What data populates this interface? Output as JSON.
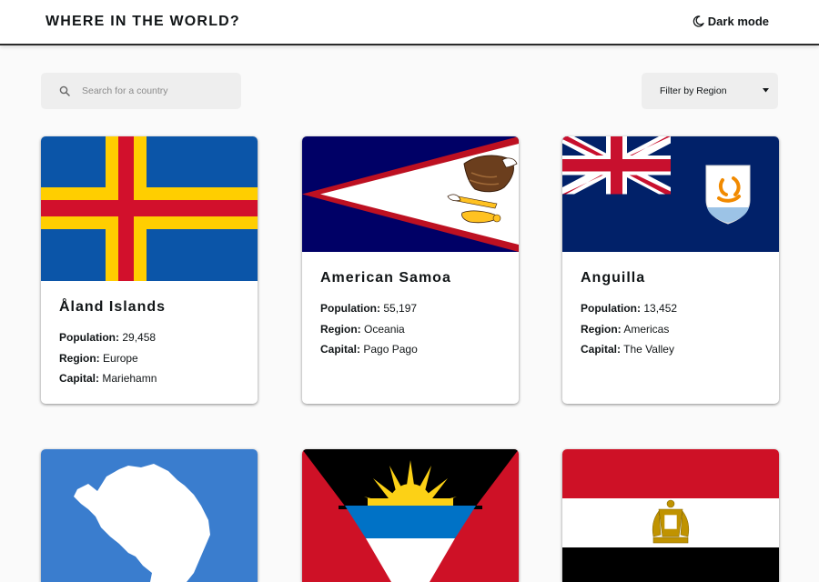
{
  "header": {
    "title": "WHERE IN THE WORLD?",
    "theme_toggle_label": "Dark mode",
    "theme_icon": "moon-icon"
  },
  "search": {
    "placeholder": "Search for a country",
    "value": "",
    "icon": "search-icon"
  },
  "filter": {
    "label": "Filter by Region",
    "icon": "caret-down-icon"
  },
  "labels": {
    "population": "Population:",
    "region": "Region:",
    "capital": "Capital:"
  },
  "countries": [
    {
      "name": "Åland Islands",
      "population": "29,458",
      "region": "Europe",
      "capital": "Mariehamn",
      "flag": "aland-flag"
    },
    {
      "name": "American Samoa",
      "population": "55,197",
      "region": "Oceania",
      "capital": "Pago Pago",
      "flag": "american-samoa-flag"
    },
    {
      "name": "Anguilla",
      "population": "13,452",
      "region": "Americas",
      "capital": "The Valley",
      "flag": "anguilla-flag"
    },
    {
      "name": "",
      "flag": "antarctica-flag"
    },
    {
      "name": "",
      "flag": "antigua-and-barbuda-flag"
    },
    {
      "name": "",
      "flag": "egypt-flag"
    }
  ],
  "colors": {
    "background": "#fafafa",
    "card": "#ffffff",
    "input": "#eeeeee",
    "text": "#111517"
  }
}
